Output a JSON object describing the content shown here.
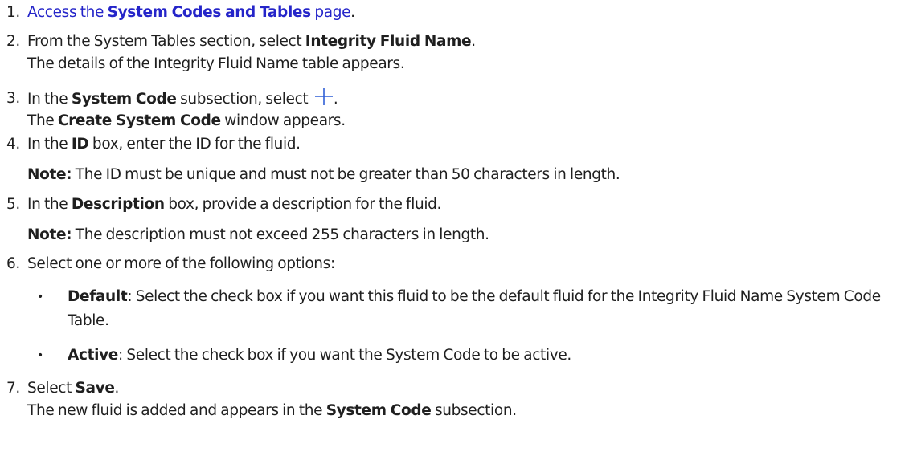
{
  "steps": [
    {
      "num": "1.",
      "pre": "",
      "link_pre": "Access the ",
      "link_bold": "System Codes and Tables",
      "link_post": " page",
      "post": "."
    },
    {
      "num": "2.",
      "pre": "From the System Tables section, select ",
      "bold": "Integrity Fluid Name",
      "post": ".",
      "result": "The details of the Integrity Fluid Name table appears."
    },
    {
      "num": "3.",
      "pre": "In the ",
      "bold": "System Code",
      "mid": " subsection, select ",
      "icon": "plus-icon",
      "post": ".",
      "result_pre": "The ",
      "result_bold": "Create System Code",
      "result_post": " window appears."
    },
    {
      "num": "4.",
      "pre": "In the ",
      "bold": "ID",
      "post": " box, enter the ID for the fluid.",
      "note_label": "Note:",
      "note_text": " The ID must be unique and must not be greater than 50 characters in length."
    },
    {
      "num": "5.",
      "pre": "In the ",
      "bold": "Description",
      "post": " box, provide a description for the fluid.",
      "note_label": "Note:",
      "note_text": " The description must not exceed 255 characters in length."
    },
    {
      "num": "6.",
      "text": "Select one or more of the following options:",
      "bullets": [
        {
          "bold": "Default",
          "text": ": Select the check box if you want this fluid to be the default fluid for the Integrity Fluid Name System Code Table."
        },
        {
          "bold": "Active",
          "text": ": Select the check box if you want the System Code to be active."
        }
      ]
    },
    {
      "num": "7.",
      "pre": "Select ",
      "bold": "Save",
      "post": ".",
      "result_pre": "The new fluid is added and appears in the ",
      "result_bold": "System Code",
      "result_post": " subsection."
    }
  ],
  "colors": {
    "link": "#2525c9",
    "text": "#1f1f1f",
    "icon": "#2f5fd6"
  }
}
